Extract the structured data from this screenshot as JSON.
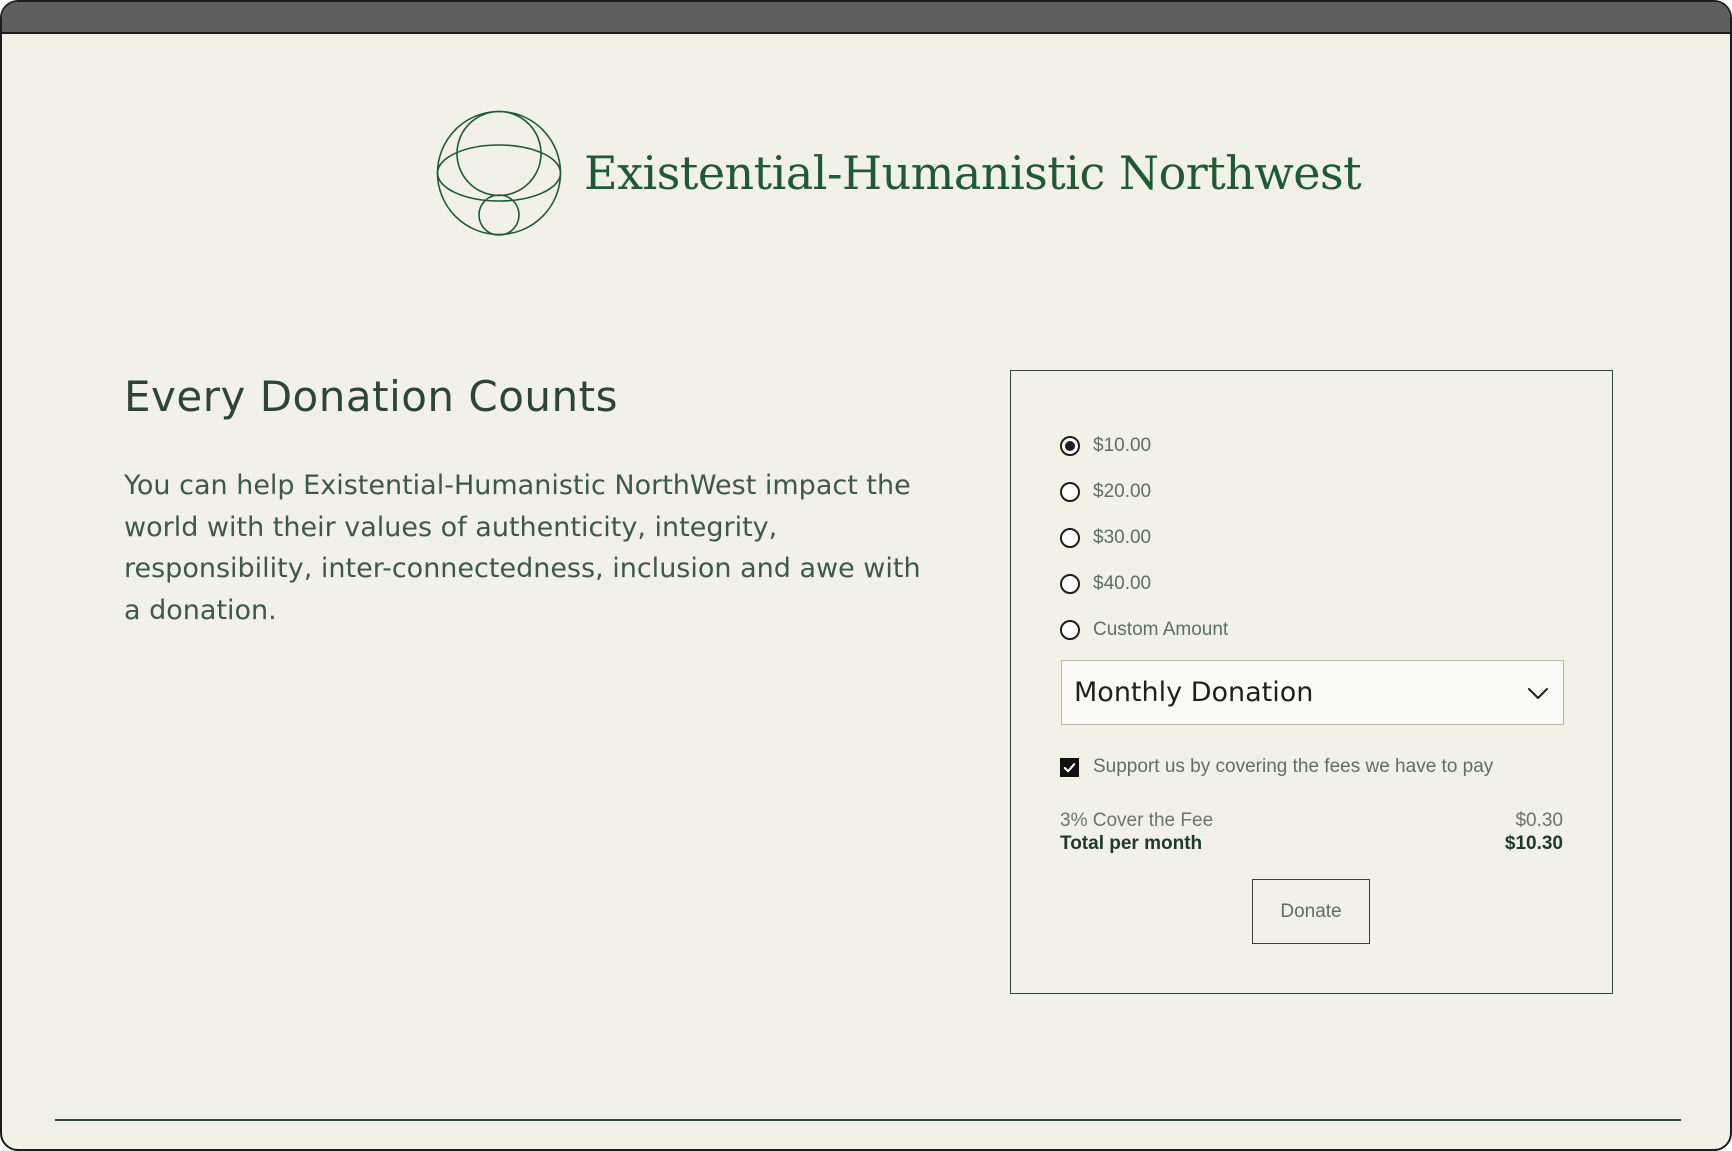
{
  "brand": {
    "name": "Existential-Humanistic Northwest",
    "logo_icon": "orbit-circles-logo-icon",
    "color": "#1f5a32"
  },
  "intro": {
    "heading": "Every Donation Counts",
    "body": "You can help Existential-Humanistic NorthWest impact the world with their values of authenticity, integrity, responsibility, inter-connectedness, inclusion and awe with a donation."
  },
  "donation_form": {
    "amount_options": [
      {
        "label": "$10.00",
        "selected": true
      },
      {
        "label": "$20.00",
        "selected": false
      },
      {
        "label": "$30.00",
        "selected": false
      },
      {
        "label": "$40.00",
        "selected": false
      },
      {
        "label": "Custom Amount",
        "selected": false
      }
    ],
    "frequency": {
      "selected": "Monthly Donation",
      "icon": "chevron-down-icon"
    },
    "cover_fees": {
      "checked": true,
      "label": "Support us by covering the fees we have to pay"
    },
    "fee_line": {
      "label": "3% Cover the Fee",
      "value": "$0.30"
    },
    "total_line": {
      "label": "Total per month",
      "value": "$10.30"
    },
    "donate_label": "Donate"
  },
  "colors": {
    "background": "#f1f1e6",
    "accent": "#1f5a32",
    "text": "#3e5a45",
    "titlebar": "#5e5e5e"
  }
}
